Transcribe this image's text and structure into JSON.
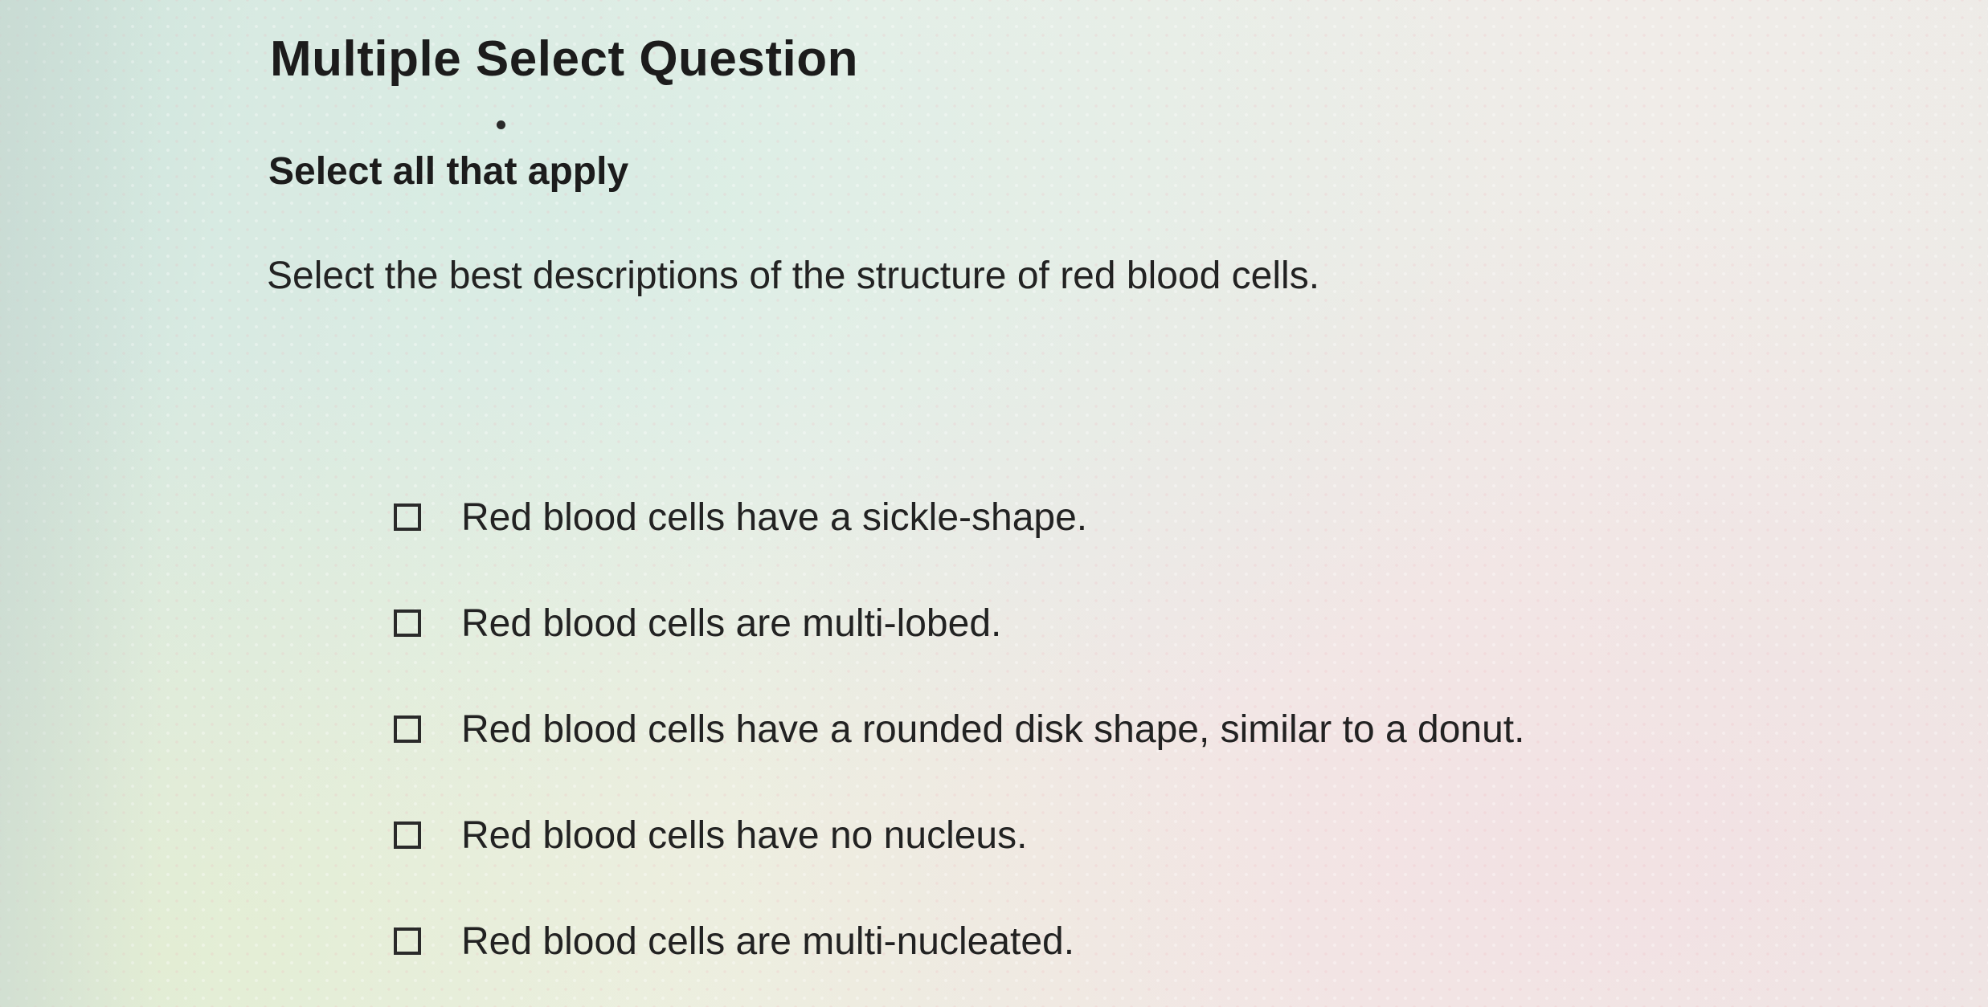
{
  "question": {
    "type_label": "Multiple Select Question",
    "instruction": "Select all that apply",
    "prompt": "Select the best descriptions of the structure of red blood cells."
  },
  "options": [
    {
      "label": "Red blood cells have a sickle-shape.",
      "checked": false
    },
    {
      "label": "Red blood cells are multi-lobed.",
      "checked": false
    },
    {
      "label": "Red blood cells have a rounded disk shape, similar to a donut.",
      "checked": false
    },
    {
      "label": "Red blood cells have no nucleus.",
      "checked": false
    },
    {
      "label": "Red blood cells are multi-nucleated.",
      "checked": false
    }
  ],
  "colors": {
    "text": "#222222",
    "checkbox_border": "#2a2a2a"
  }
}
